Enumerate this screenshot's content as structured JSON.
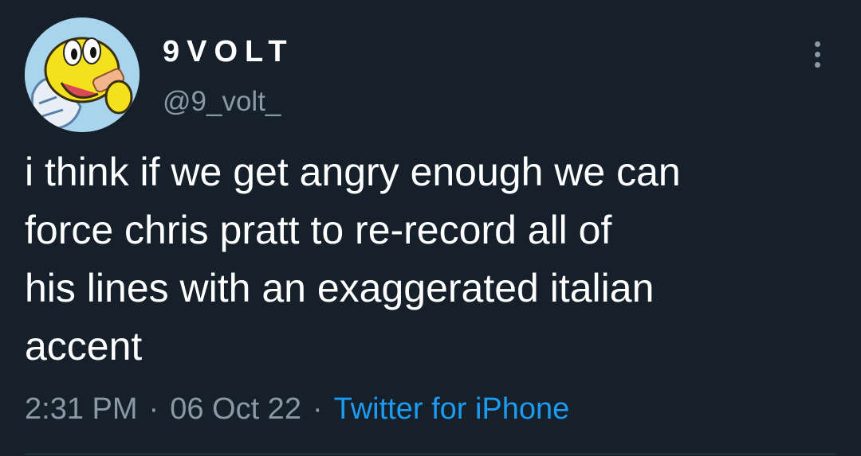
{
  "tweet": {
    "display_name": "9VOLT",
    "handle": "@9_volt_",
    "text": "i think if we get angry enough we can\nforce chris pratt to re-record all of\nhis lines with an exaggerated italian\naccent",
    "time": "2:31 PM",
    "separator": "·",
    "date": "06 Oct 22",
    "source": "Twitter for iPhone"
  },
  "icons": {
    "avatar": "koopa-character-avatar",
    "more": "more-options-icon"
  },
  "colors": {
    "background": "#15202b",
    "text": "#ffffff",
    "secondary": "#8b98a5",
    "link": "#1d9bf0"
  }
}
